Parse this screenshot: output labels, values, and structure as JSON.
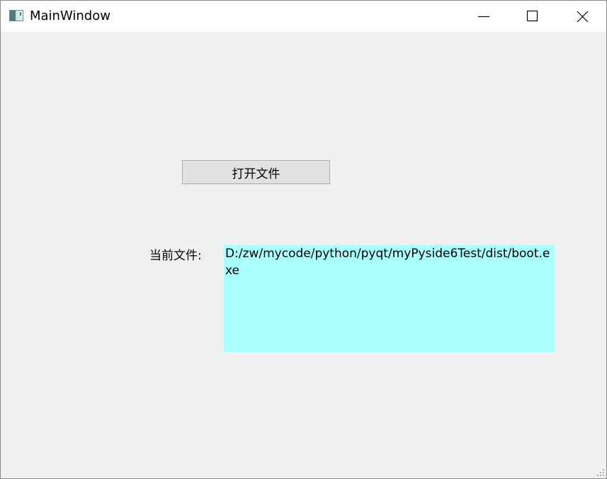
{
  "window": {
    "title": "MainWindow",
    "app_icon": "app-window-icon",
    "controls": {
      "minimize_icon": "minimize-icon",
      "maximize_icon": "maximize-icon",
      "close_icon": "close-icon"
    }
  },
  "main": {
    "open_button_label": "打开文件",
    "current_file_label": "当前文件:",
    "current_file_path": "D:/zw/mycode/python/pyqt/myPyside6Test/dist/boot.exe"
  },
  "colors": {
    "client_background": "#f0f0f0",
    "path_box_background": "#aaffff",
    "button_background": "#e1e1e1"
  }
}
